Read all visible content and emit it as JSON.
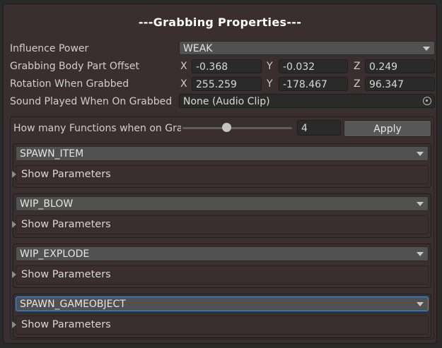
{
  "panel": {
    "title": "---Grabbing Properties---"
  },
  "properties": {
    "influence_power": {
      "label": "Influence Power",
      "value": "WEAK"
    },
    "offset": {
      "label": "Grabbing Body Part Offset",
      "x_label": "X",
      "x": "-0.368",
      "y_label": "Y",
      "y": "-0.032",
      "z_label": "Z",
      "z": "0.249"
    },
    "rotation": {
      "label": "Rotation When Grabbed",
      "x_label": "X",
      "x": "255.259",
      "y_label": "Y",
      "y": "-178.467",
      "z_label": "Z",
      "z": "96.347"
    },
    "sound": {
      "label": "Sound Played When On Grabbed",
      "value": "None (Audio Clip)"
    }
  },
  "functions": {
    "count_label": "How many Functions when on Grabbed",
    "count_value": "4",
    "slider_fraction": 0.4,
    "apply_label": "Apply",
    "items": [
      {
        "name": "SPAWN_ITEM",
        "foldout": "Show Parameters"
      },
      {
        "name": "WIP_BLOW",
        "foldout": "Show Parameters"
      },
      {
        "name": "WIP_EXPLODE",
        "foldout": "Show Parameters"
      },
      {
        "name": "SPAWN_GAMEOBJECT",
        "foldout": "Show Parameters"
      }
    ]
  },
  "icons": {
    "dropdown": "chevron-down-icon",
    "object_picker": "object-picker-icon",
    "foldout": "triangle-right-icon"
  }
}
